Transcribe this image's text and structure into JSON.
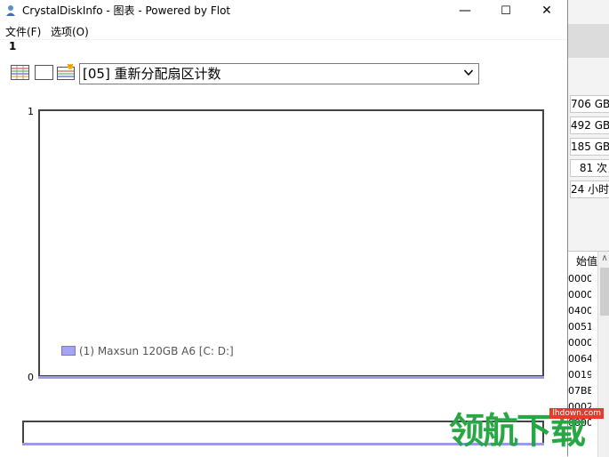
{
  "window": {
    "title": "CrystalDiskInfo - 图表 - Powered by Flot",
    "minimize": "—",
    "maximize": "☐",
    "close": "✕"
  },
  "menu": [
    "文件(F)",
    "选项(O)"
  ],
  "drive_label": "1",
  "selector": {
    "value": "[05] 重新分配扇区计数"
  },
  "toolbar": [
    "chart-lines-icon",
    "blank-icon",
    "chart-image-icon"
  ],
  "chart_data": {
    "type": "line",
    "y_ticks": [
      "1",
      "0"
    ],
    "ylim": [
      0,
      1
    ],
    "series": [
      {
        "name": "(1) Maxsun 120GB A6 [C: D:]",
        "values": [
          0
        ],
        "color": "#9a9ae6"
      }
    ],
    "legend": "bottom-left"
  },
  "background_window": {
    "values": [
      "706 GB",
      "492 GB",
      "185 GB",
      "81 次",
      "24 小时"
    ],
    "table_header": "始值",
    "table_cells": [
      "0000",
      "0000",
      "0400",
      "0051",
      "0000",
      "0064",
      "0019",
      "07BB",
      "0002",
      "0000"
    ]
  },
  "watermark": {
    "big": "领航下载",
    "small": "lhdown.com"
  }
}
